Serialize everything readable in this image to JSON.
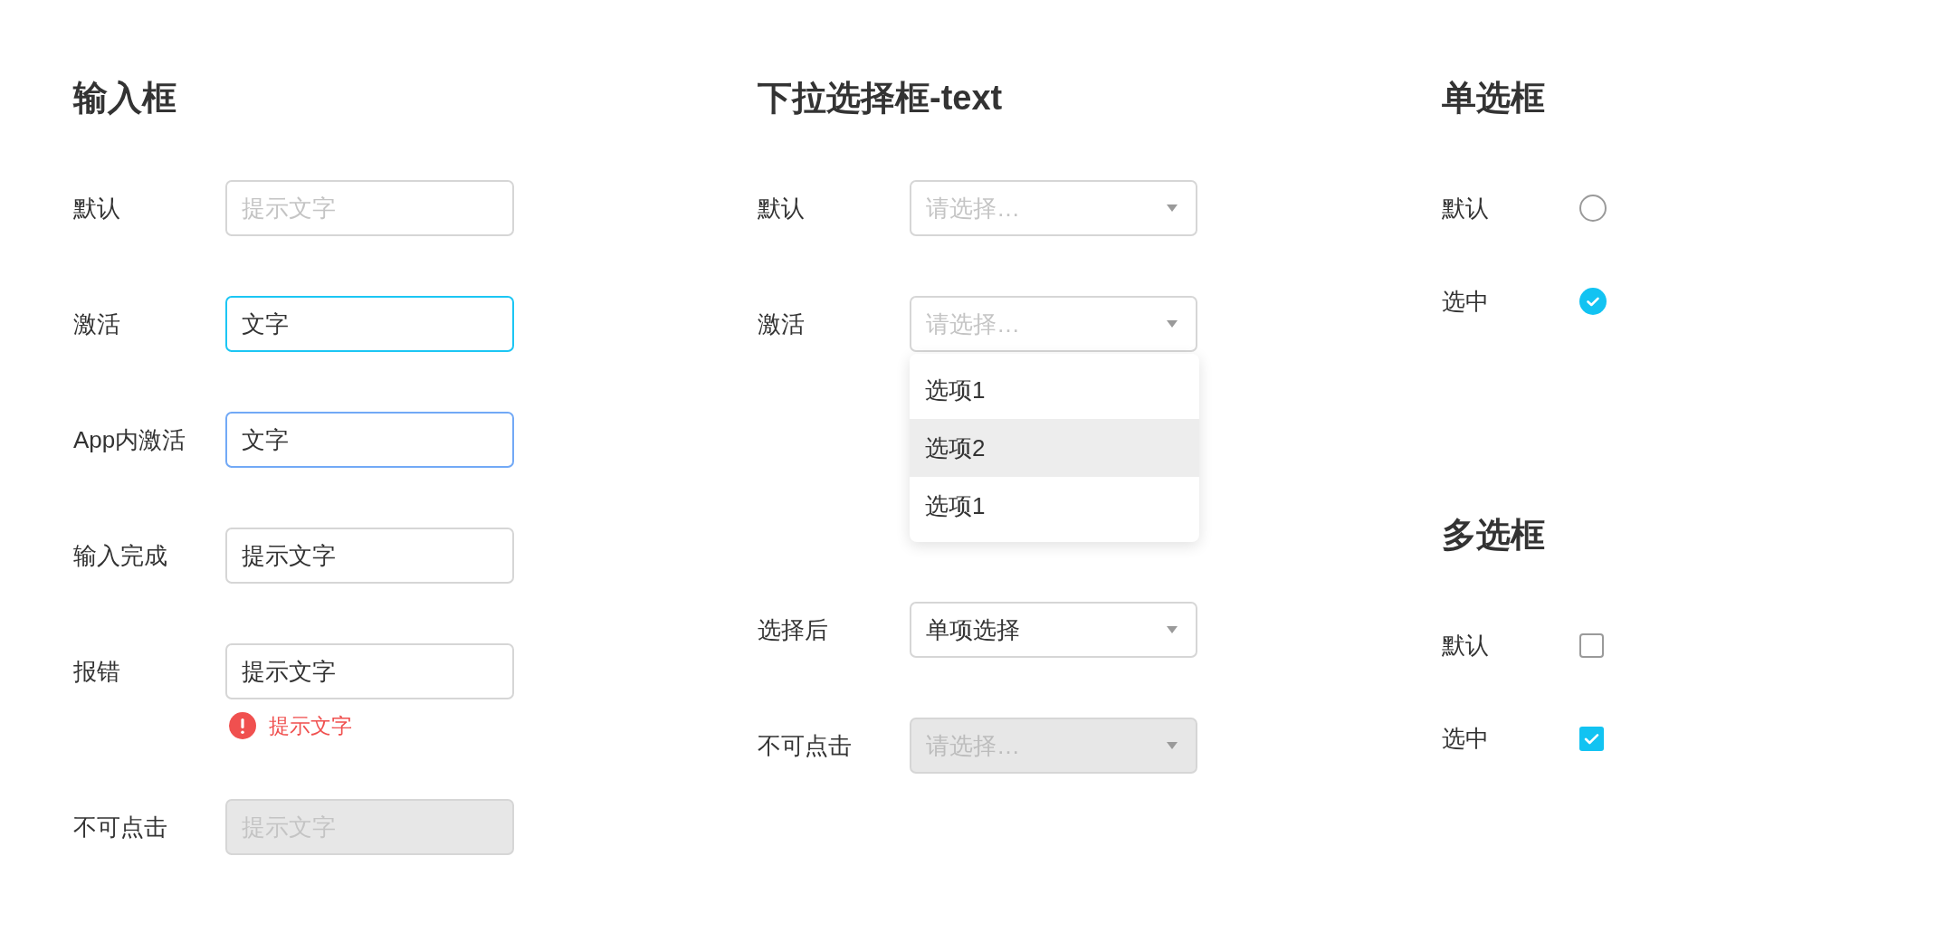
{
  "input_section": {
    "title": "输入框",
    "rows": [
      {
        "label": "默认",
        "kind": "default",
        "placeholder": "提示文字"
      },
      {
        "label": "激活",
        "kind": "active",
        "value": "文字"
      },
      {
        "label": "App内激活",
        "kind": "app_active",
        "value": "文字"
      },
      {
        "label": "输入完成",
        "kind": "default",
        "value": "提示文字"
      },
      {
        "label": "报错",
        "kind": "default",
        "value": "提示文字",
        "error": "提示文字"
      },
      {
        "label": "不可点击",
        "kind": "disabled",
        "placeholder": "提示文字"
      }
    ]
  },
  "select_section": {
    "title": "下拉选择框-text",
    "rows": [
      {
        "label": "默认",
        "placeholder": "请选择…",
        "disabled": false
      },
      {
        "label": "激活",
        "placeholder": "请选择…",
        "disabled": false,
        "options": [
          {
            "label": "选项1",
            "selected": false
          },
          {
            "label": "选项2",
            "selected": true
          },
          {
            "label": "选项1",
            "selected": false
          }
        ]
      },
      {
        "label": "选择后",
        "value": "单项选择",
        "disabled": false
      },
      {
        "label": "不可点击",
        "placeholder": "请选择…",
        "disabled": true
      }
    ]
  },
  "radio_section": {
    "title": "单选框",
    "rows": [
      {
        "label": "默认",
        "checked": false
      },
      {
        "label": "选中",
        "checked": true
      }
    ]
  },
  "checkbox_section": {
    "title": "多选框",
    "rows": [
      {
        "label": "默认",
        "checked": false
      },
      {
        "label": "选中",
        "checked": true
      }
    ]
  }
}
